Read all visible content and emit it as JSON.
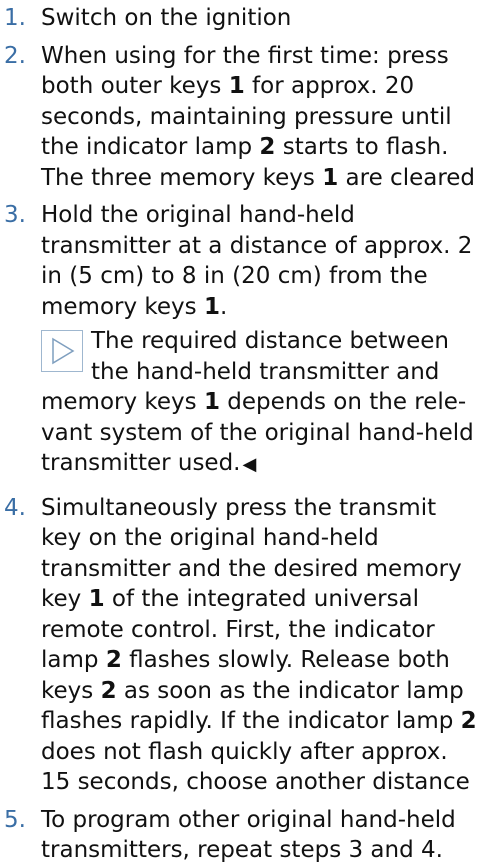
{
  "steps": [
    {
      "number": "1.",
      "parts": [
        {
          "t": "Switch on the ignition",
          "b": false
        }
      ]
    },
    {
      "number": "2.",
      "parts": [
        {
          "t": "When using for the first time: press both outer keys ",
          "b": false
        },
        {
          "t": "1",
          "b": true
        },
        {
          "t": " for approx. 20 seconds, maintaining pressure until the indicator lamp ",
          "b": false
        },
        {
          "t": "2",
          "b": true
        },
        {
          "t": " starts to flash. The three memory keys ",
          "b": false
        },
        {
          "t": "1",
          "b": true
        },
        {
          "t": " are cleared",
          "b": false
        }
      ]
    },
    {
      "number": "3.",
      "parts": [
        {
          "t": "Hold the original hand-held transmitter at a distance of approx. 2 in (5 cm) to 8 in (20 cm) from the memory keys ",
          "b": false
        },
        {
          "t": "1",
          "b": true
        },
        {
          "t": ".",
          "b": false
        }
      ]
    },
    {
      "number": "4.",
      "parts": [
        {
          "t": "Simultaneously press the transmit key on the original hand-held transmitter and the desired memory key ",
          "b": false
        },
        {
          "t": "1",
          "b": true
        },
        {
          "t": " of the integrated universal remote control. First, the indicator lamp ",
          "b": false
        },
        {
          "t": "2",
          "b": true
        },
        {
          "t": " flashes slowly. Release both keys ",
          "b": false
        },
        {
          "t": "2",
          "b": true
        },
        {
          "t": " as soon as the indicator lamp flashes rapidly. If the indicator lamp ",
          "b": false
        },
        {
          "t": "2",
          "b": true
        },
        {
          "t": " does not flash quickly after approx. 15 seconds, choose another distance",
          "b": false
        }
      ]
    },
    {
      "number": "5.",
      "parts": [
        {
          "t": "To program other original hand-held transmitters, repeat steps 3 and 4.",
          "b": false
        }
      ]
    }
  ],
  "note": {
    "icon": "play-triangle-icon",
    "parts": [
      {
        "t": "The required distance between the hand-held transmitter and memory keys ",
        "b": false
      },
      {
        "t": "1",
        "b": true
      },
      {
        "t": " depends on the rele-vant system of the original hand-held transmitter used.",
        "b": false
      }
    ],
    "end_mark": "◀"
  },
  "colors": {
    "step_number": "#3a6ea5",
    "icon_border": "#9fb7cf",
    "icon_stroke": "#7f9fbf"
  }
}
